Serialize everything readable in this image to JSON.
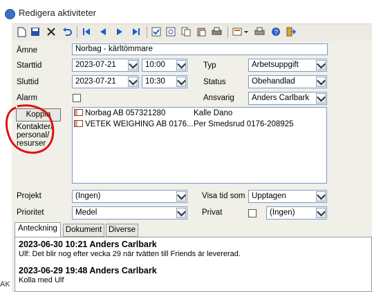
{
  "window": {
    "title": "Redigera aktiviteter",
    "icon": "app-globe-icon"
  },
  "toolbar": {
    "icons": [
      "new-document-icon",
      "save-icon",
      "delete-icon",
      "undo-icon",
      "first-record-icon",
      "previous-record-icon",
      "next-record-icon",
      "last-record-icon",
      "check-icon",
      "preview-icon",
      "copy-icon",
      "paste-icon",
      "print-icon",
      "settings-dropdown-icon",
      "printer-icon",
      "help-icon",
      "exit-icon"
    ]
  },
  "form": {
    "amne": {
      "label": "Ämne",
      "value": "Norbag - kärltömmare"
    },
    "starttid": {
      "label": "Starttid",
      "date": "2023-07-21",
      "time": "10:00"
    },
    "sluttid": {
      "label": "Sluttid",
      "date": "2023-07-21",
      "time": "10:30"
    },
    "alarm": {
      "label": "Alarm"
    },
    "typ": {
      "label": "Typ",
      "value": "Arbetsuppgift"
    },
    "status": {
      "label": "Status",
      "value": "Obehandlad"
    },
    "ansvarig": {
      "label": "Ansvarig",
      "value": "Anders  Carlbark"
    },
    "koppla": {
      "button": "Koppla",
      "caption1": "Kontakter/",
      "caption2": "personal/",
      "caption3": "resurser"
    },
    "contacts": [
      {
        "company": "Norbag AB 057321280",
        "person": "Kalle Dano"
      },
      {
        "company": "VETEK WEIGHING AB 0176...",
        "person": "Per Smedsrud 0176-208925"
      }
    ],
    "projekt": {
      "label": "Projekt",
      "value": "(Ingen)"
    },
    "prioritet": {
      "label": "Prioritet",
      "value": "Medel"
    },
    "visa_tid_som": {
      "label": "Visa tid som",
      "value": "Upptagen"
    },
    "privat": {
      "label": "Privat",
      "value": "(Ingen)"
    }
  },
  "tabs": [
    {
      "label": "Anteckning",
      "active": true
    },
    {
      "label": "Dokument",
      "active": false
    },
    {
      "label": "Diverse",
      "active": false
    }
  ],
  "notes": [
    {
      "header": "2023-06-30 10:21 Anders Carlbark",
      "text": "Ulf: Det blir nog efter vecka 29 när tvätten till Friends är levererad."
    },
    {
      "header": "2023-06-29 19:48 Anders Carlbark",
      "text": "Kolla med Ulf"
    }
  ],
  "edge_text": "AK",
  "annotation_color": "#e01010"
}
